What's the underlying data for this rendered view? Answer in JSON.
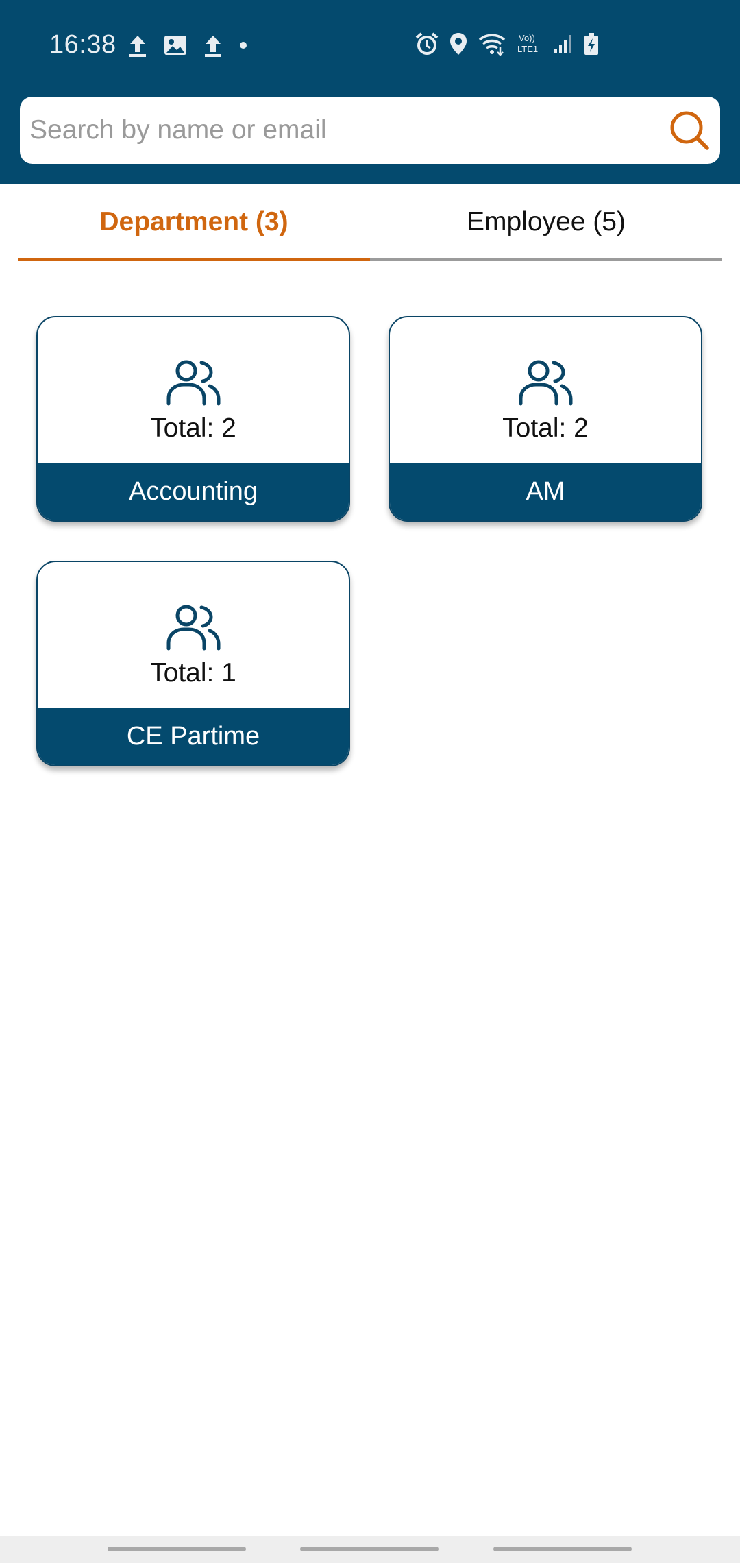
{
  "status_bar": {
    "time": "16:38"
  },
  "search": {
    "placeholder": "Search by name or email",
    "value": ""
  },
  "tabs": [
    {
      "label": "Department (3)",
      "active": true
    },
    {
      "label": "Employee (5)",
      "active": false
    }
  ],
  "departments": [
    {
      "name": "Accounting",
      "total": "Total: 2",
      "icon": "people-icon"
    },
    {
      "name": "AM",
      "total": "Total: 2",
      "icon": "people-icon"
    },
    {
      "name": "CE Partime",
      "total": "Total: 1",
      "icon": "people-icon"
    }
  ],
  "colors": {
    "primary": "#044a6e",
    "accent": "#d0660f",
    "tab_inactive_line": "#9b9b9b"
  }
}
